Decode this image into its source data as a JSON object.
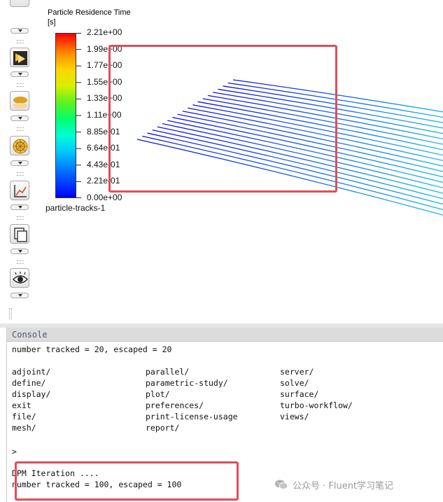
{
  "toolbar": {
    "buttons": [
      {
        "name": "contours-icon",
        "top": 0,
        "visible_label": ""
      },
      {
        "name": "vectors-icon"
      },
      {
        "name": "pathlines-icon"
      },
      {
        "name": "particle-tracks-icon"
      },
      {
        "name": "xy-plot-icon"
      },
      {
        "name": "scene-icon"
      },
      {
        "name": "view-icon"
      }
    ]
  },
  "colorbar": {
    "title": "Particle Residence Time",
    "unit": "[s]",
    "labels": [
      "2.21e+00",
      "1.99e+00",
      "1.77e+00",
      "1.55e+00",
      "1.33e+00",
      "1.11e+00",
      "8.85e-01",
      "6.64e-01",
      "4.43e-01",
      "2.21e-01",
      "0.00e+00"
    ],
    "range": [
      0,
      2.21
    ]
  },
  "graphics": {
    "object_name": "particle-tracks-1",
    "track_count": 20,
    "track_colors": {
      "start": "#1010e0",
      "end": "#19c8e6"
    }
  },
  "console": {
    "title": "Console",
    "line1": "number tracked = 20, escaped = 20",
    "menu_columns": [
      [
        "adjoint/",
        "define/",
        "display/",
        "exit",
        "file/",
        "mesh/"
      ],
      [
        "parallel/",
        "parametric-study/",
        "plot/",
        "preferences/",
        "print-license-usage",
        "report/"
      ],
      [
        "server/",
        "solve/",
        "surface/",
        "turbo-workflow/",
        "views/"
      ]
    ],
    "prompt": ">",
    "dpm_iteration": "DPM Iteration ....",
    "line_last": "number tracked = 100, escaped = 100"
  },
  "watermark": {
    "text": "公众号 · Fluent学习笔记"
  },
  "colors": {
    "highlight": "#e04d58",
    "console_header": "#dcdcdc"
  }
}
